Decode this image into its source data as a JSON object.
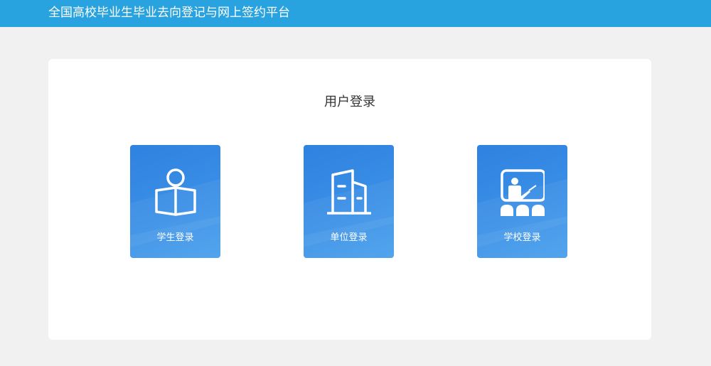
{
  "header": {
    "title": "全国高校毕业生毕业去向登记与网上签约平台",
    "color": "#29a3df"
  },
  "login": {
    "title": "用户登录",
    "options": [
      {
        "label": "学生登录",
        "icon": "student-reading-icon"
      },
      {
        "label": "单位登录",
        "icon": "building-icon"
      },
      {
        "label": "学校登录",
        "icon": "teacher-classroom-icon"
      }
    ]
  }
}
